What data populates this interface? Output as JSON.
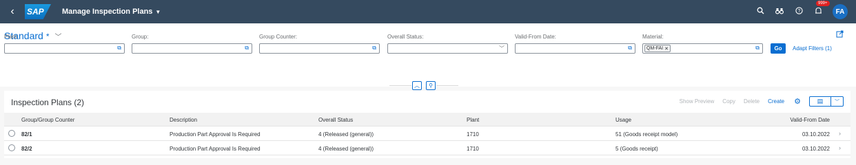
{
  "shell": {
    "back_icon": "‹",
    "logo": "SAP",
    "title": "Manage Inspection Plans",
    "notifications_badge": "999+",
    "avatar_initials": "FA"
  },
  "variant": {
    "name": "Standard",
    "dirty_marker": "*"
  },
  "filters": [
    {
      "label": "Plant:",
      "value": ""
    },
    {
      "label": "Group:",
      "value": ""
    },
    {
      "label": "Group Counter:",
      "value": ""
    },
    {
      "label": "Overall Status:",
      "value": ""
    },
    {
      "label": "Valid-From Date:",
      "value": ""
    },
    {
      "label": "Material:",
      "token": "QM-FAI"
    }
  ],
  "filterbar": {
    "go_label": "Go",
    "adapt_label": "Adapt Filters (1)"
  },
  "table": {
    "title": "Inspection Plans (2)",
    "toolbar": {
      "show_preview": "Show Preview",
      "copy": "Copy",
      "delete": "Delete",
      "create": "Create"
    },
    "columns": [
      "Group/Group Counter",
      "Description",
      "Overall Status",
      "Plant",
      "Usage",
      "Valid-From Date"
    ],
    "rows": [
      {
        "group": "82/1",
        "description": "Production Part Approval Is Required",
        "status": "4 (Released (general))",
        "plant": "1710",
        "usage": "51 (Goods receipt model)",
        "valid_from": "03.10.2022"
      },
      {
        "group": "82/2",
        "description": "Production Part Approval Is Required",
        "status": "4 (Released (general))",
        "plant": "1710",
        "usage": "5 (Goods receipt)",
        "valid_from": "03.10.2022"
      }
    ]
  },
  "colors": {
    "shell_bg": "#354a5f",
    "accent": "#0a6ed1"
  }
}
